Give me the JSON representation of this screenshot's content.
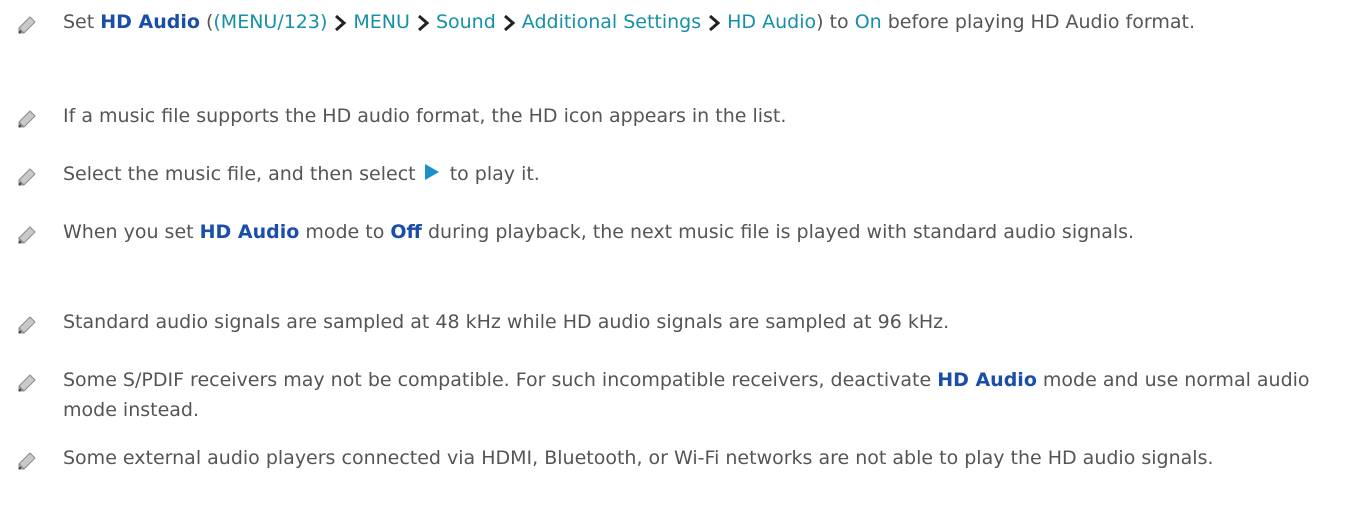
{
  "notes": [
    {
      "icon": "pencil-note-icon",
      "parts": {
        "p1": "Set ",
        "p2": "HD Audio",
        "p3": " (",
        "p4": "(MENU/123)",
        "p5": "MENU",
        "p6": "Sound",
        "p7": "Additional Settings",
        "p8": "HD Audio",
        "p9": ") to ",
        "p10": "On",
        "p11": " before playing HD Audio format."
      }
    },
    {
      "icon": "pencil-note-icon",
      "text": "If a music file supports the HD audio format, the HD icon appears in the list."
    },
    {
      "icon": "pencil-note-icon",
      "parts": {
        "p1": "Select the music file, and then select ",
        "p2": " to play it."
      }
    },
    {
      "icon": "pencil-note-icon",
      "parts": {
        "p1": "When you set ",
        "p2": "HD Audio",
        "p3": " mode to ",
        "p4": "Off",
        "p5": " during playback, the next music file is played with standard audio signals."
      }
    },
    {
      "icon": "pencil-note-icon",
      "text": "Standard audio signals are sampled at 48 kHz while HD audio signals are sampled at 96 kHz."
    },
    {
      "icon": "pencil-note-icon",
      "parts": {
        "p1": "Some S/PDIF receivers may not be compatible. For such incompatible receivers, deactivate ",
        "p2": "HD Audio",
        "p3": " mode and use normal audio mode instead."
      }
    },
    {
      "icon": "pencil-note-icon",
      "text": "Some external audio players connected via HDMI, Bluetooth, or Wi-Fi networks are not able to play the HD audio signals."
    }
  ],
  "colors": {
    "highlight": "#1a4ea8",
    "menu_path": "#1590a8",
    "body_text": "#555555",
    "play_icon": "#1a90c8"
  },
  "inline_icons": {
    "separator": "chevron-right-icon",
    "play": "play-icon"
  }
}
